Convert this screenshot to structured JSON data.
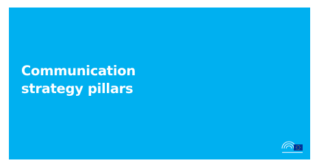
{
  "slide": {
    "background_color": "#00b0f0",
    "title_line_1": "Communication",
    "title_line_2": "strategy pillars",
    "title_color": "#ffffff"
  },
  "logo": {
    "icon": "european-parliament-logo-icon",
    "caption": "European Parliament",
    "flag_color": "#003399",
    "star_color": "#ffdd00"
  }
}
